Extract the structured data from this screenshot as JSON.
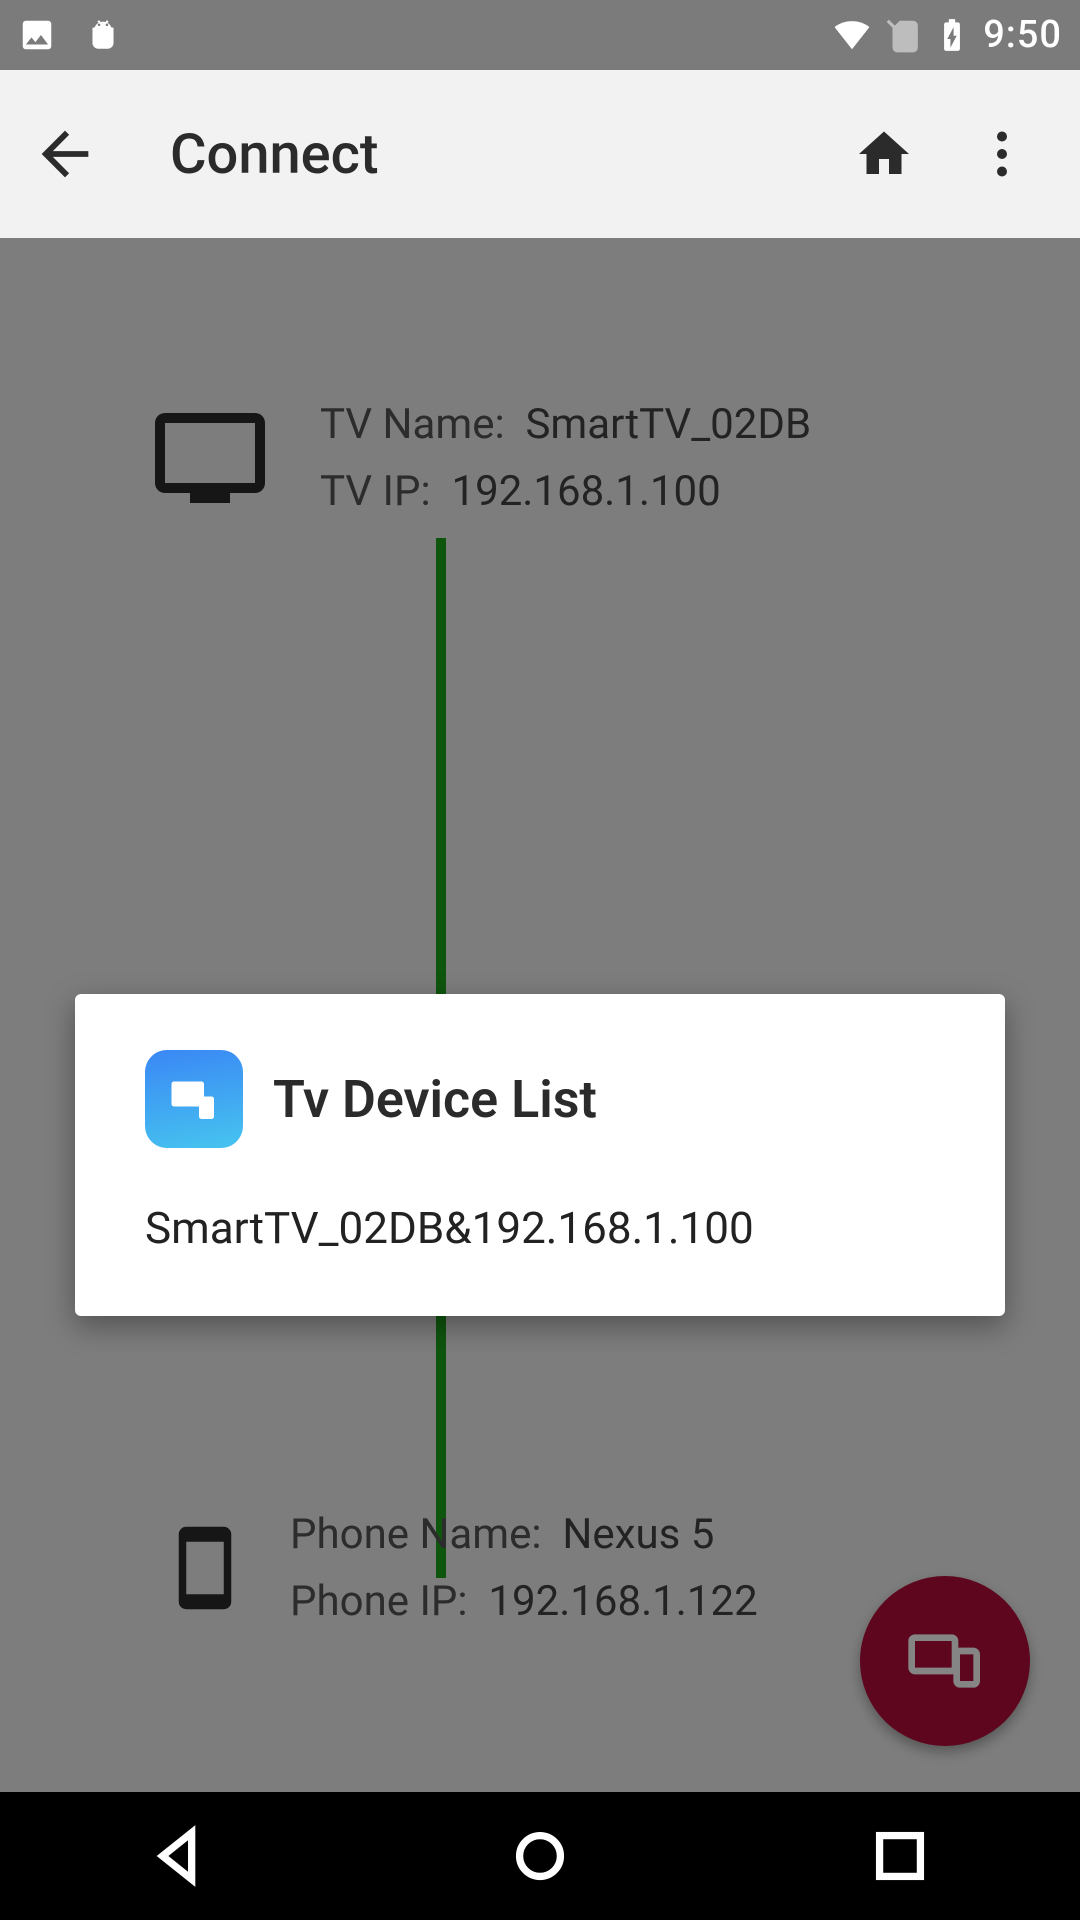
{
  "statusbar": {
    "time": "9:50"
  },
  "appbar": {
    "title": "Connect"
  },
  "content": {
    "tv_name_label": "TV Name:",
    "tv_name_value": "SmartTV_02DB",
    "tv_ip_label": "TV IP:",
    "tv_ip_value": "192.168.1.100",
    "phone_name_label": "Phone Name:",
    "phone_name_value": "Nexus 5",
    "phone_ip_label": "Phone IP:",
    "phone_ip_value": "192.168.1.122"
  },
  "dialog": {
    "title": "Tv Device List",
    "items": [
      "SmartTV_02DB&192.168.1.100"
    ]
  },
  "colors": {
    "connection_line": "#1BA41B",
    "fab": "#B40D3B",
    "app_icon_gradient_from": "#3A87F5",
    "app_icon_gradient_to": "#46C4EF"
  }
}
